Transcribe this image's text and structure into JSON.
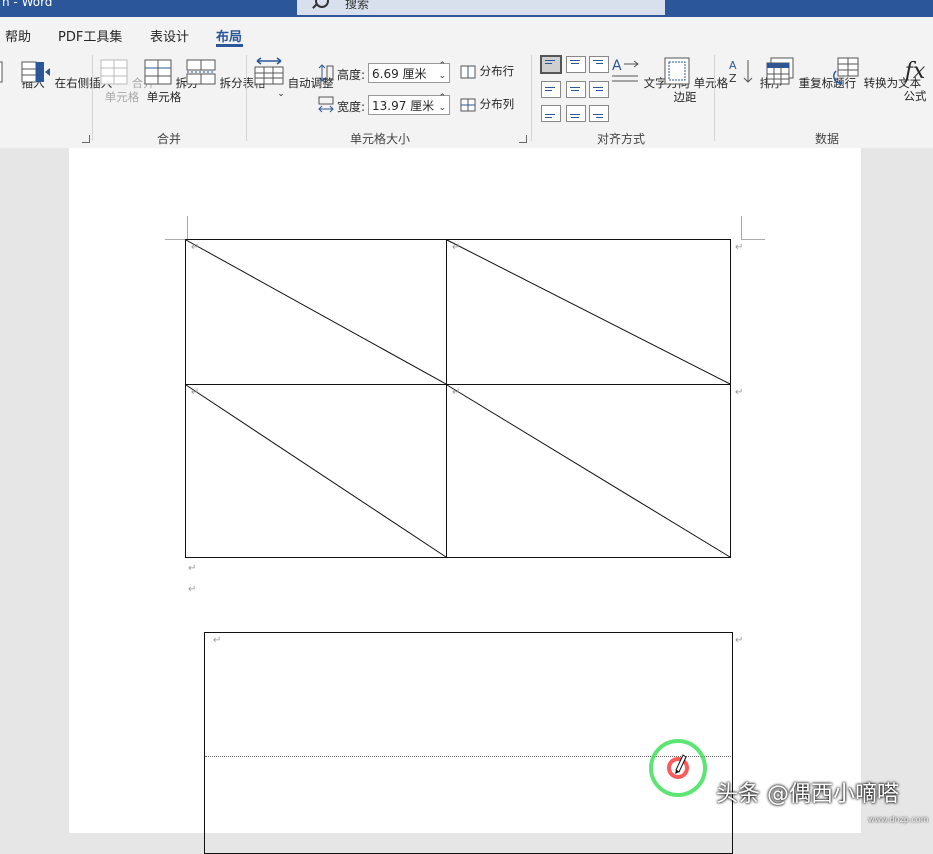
{
  "window": {
    "title": "n  -  Word"
  },
  "search": {
    "placeholder": "搜索"
  },
  "tabs": [
    {
      "label": "帮助"
    },
    {
      "label": "PDF工具集"
    },
    {
      "label": "表设计"
    },
    {
      "label": "布局",
      "active": true
    }
  ],
  "ribbon": {
    "rows_cols": {
      "insert_left_partial": "插入",
      "insert_right": "在右侧插入"
    },
    "merge": {
      "merge_cells": "合并\n单元格",
      "split_cells": "拆分\n单元格",
      "split_table": "拆分表格",
      "group_label": "合并"
    },
    "cell_size": {
      "autofit": "自动调整",
      "height_label": "高度:",
      "height_value": "6.69 厘米",
      "width_label": "宽度:",
      "width_value": "13.97 厘米",
      "distribute_rows": "分布行",
      "distribute_cols": "分布列",
      "group_label": "单元格大小"
    },
    "alignment": {
      "text_direction": "文字方向",
      "cell_margins": "单元格\n边距",
      "group_label": "对齐方式"
    },
    "data": {
      "sort": "排序",
      "repeat_header": "重复标题行",
      "convert_to_text": "转换为文本",
      "formula": "公式",
      "group_label": "数据"
    }
  },
  "document": {
    "paragraph_mark": "↵"
  },
  "watermark": {
    "text": "头条 @偶西小嘀嗒",
    "sub": "www.dnzp.com"
  },
  "colors": {
    "accent": "#2b579a",
    "title_bar": "#2b579a",
    "ribbon_bg": "#f3f3f3",
    "cursor_ring": "#3fe05a",
    "cursor_core": "#ff3030"
  }
}
